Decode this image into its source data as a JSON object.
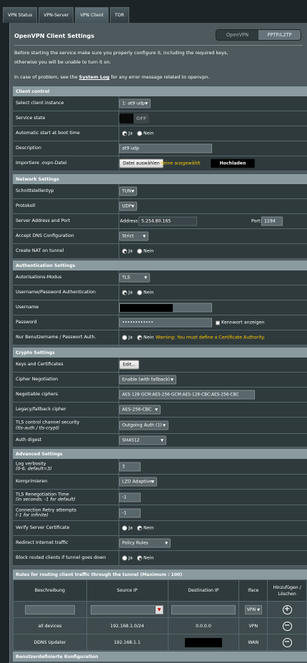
{
  "tabs": [
    "VPN Status",
    "VPN-Server",
    "VPN Client",
    "TOR"
  ],
  "title": "OpenVPN Client Settings",
  "segments": [
    "OpenVPN",
    "PPTP/L2TP"
  ],
  "intro": {
    "line1": "Before starting the service make sure you properly configure it, including the required keys,",
    "line2": "otherwise you will be unable to turn it on.",
    "line3_pre": "In case of problem, see the ",
    "line3_link": "System Log",
    "line3_post": " for any error message related to openvpn."
  },
  "client_control": {
    "header": "Client control",
    "instance_label": "Select client instance",
    "instance_value": "1: at9 udp",
    "service_label": "Service state",
    "service_value": "OFF",
    "autostart_label": "Automatic start at boot time",
    "ja": "Ja",
    "nein": "Nein",
    "desc_label": "Description",
    "desc_value": "at9 udp",
    "import_label": "Importiere .ovpn-Datei",
    "file_button": "Datei auswählen",
    "file_none": "Keine ausgewählt",
    "upload_button": "Hochladen"
  },
  "network": {
    "header": "Network Settings",
    "iface_label": "Schnittstellentyp",
    "iface_value": "TUN",
    "proto_label": "Protokoll",
    "proto_value": "UDP",
    "server_label": "Server Address and Port",
    "address_label": "Address:",
    "address_value": "5.254.80.165",
    "port_label": "Port:",
    "port_value": "1194",
    "dns_label": "Accept DNS Configuration",
    "dns_value": "Strict",
    "nat_label": "Create NAT on tunnel"
  },
  "auth": {
    "header": "Authentication Settings",
    "mode_label": "Autorisations-Modus",
    "mode_value": "TLS",
    "userpass_label": "Username/Password Authentication",
    "username_label": "Username",
    "password_label": "Password",
    "password_value": "••••••••••••",
    "show_pw": "Kennwort anzeigen",
    "only_label": "Nur Benutzername / Passwort Auth.",
    "warning": "Warning: You must define a Certificate Authority."
  },
  "crypto": {
    "header": "Crypto Settings",
    "keys_label": "Keys and Certificates",
    "keys_button": "Edit...",
    "cipher_neg_label": "Cipher Negotiation",
    "cipher_neg_value": "Enable (with fallback)",
    "ciphers_label": "Negotiable ciphers",
    "ciphers_value": "AES-128-GCM:AES-256-GCM:AES-128-CBC:AES-256-CBC",
    "legacy_label": "Legacy/fallback cipher",
    "legacy_value": "AES-256-CBC",
    "tls_label_1": "TLS control channel security",
    "tls_label_2": "(tls-auth / tls-crypt)",
    "tls_value": "Outgoing Auth (1)",
    "digest_label": "Auth digest",
    "digest_value": "SHA512"
  },
  "advanced": {
    "header": "Advanced Settings",
    "log_label_1": "Log verbosity",
    "log_label_2": "(0-6, default=3)",
    "log_value": "3",
    "comp_label": "Komprimieren",
    "comp_value": "LZO Adaptive",
    "reneg_label_1": "TLS Renegotiation Time",
    "reneg_label_2": "(in seconds, -1 for default)",
    "reneg_value": "-1",
    "retry_label_1": "Connection Retry attempts",
    "retry_label_2": "(-1 for infinite)",
    "retry_value": "-1",
    "verify_label": "Verify Server Certificate",
    "redirect_label": "Redirect Internet traffic",
    "redirect_value": "Policy Rules",
    "block_label": "Block routed clients if tunnel goes down"
  },
  "routing": {
    "header": "Rules for routing client traffic through the tunnel (Maximum : 100)",
    "columns": [
      "Beschreibung",
      "Source IP",
      "Destination IP",
      "Iface",
      "Hinzufügen / Löschen"
    ],
    "new_iface": "VPN",
    "rows": [
      {
        "desc": "all devices",
        "source": "192.168.1.0/24",
        "dest": "0.0.0.0",
        "iface": "VPN"
      },
      {
        "desc": "DDNS Updater",
        "source": "192.168.1.1",
        "dest": "",
        "iface": "WAN"
      }
    ]
  },
  "custom": {
    "header": "Benutzerdefinierte Konfiguration"
  }
}
